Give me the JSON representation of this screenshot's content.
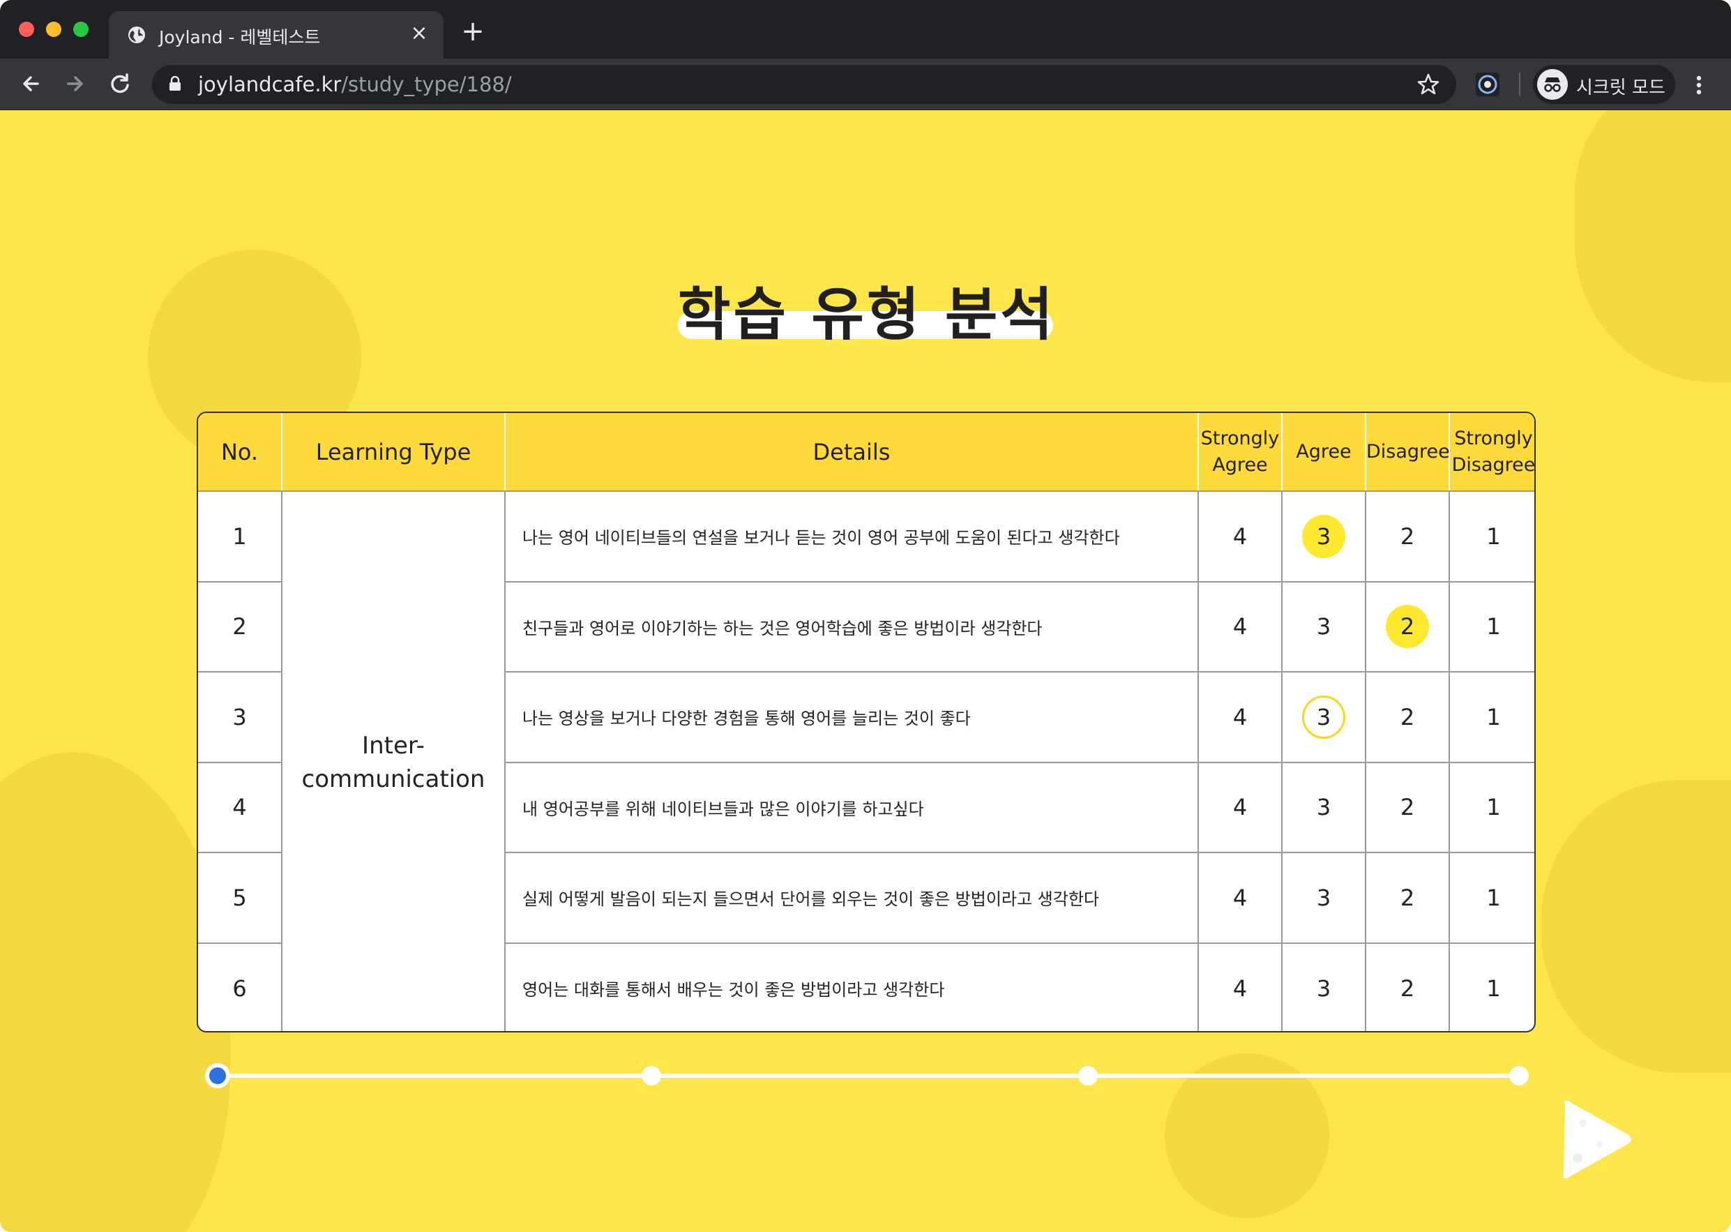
{
  "browser": {
    "tab_title": "Joyland - 레벨테스트",
    "url_host": "joylandcafe.kr",
    "url_path": "/study_type/188/",
    "incognito_label": "시크릿 모드"
  },
  "page": {
    "title": "학습 유형 분석",
    "headers": {
      "no": "No.",
      "learning_type": "Learning Type",
      "details": "Details",
      "strongly_agree_1": "Strongly",
      "strongly_agree_2": "Agree",
      "agree": "Agree",
      "disagree": "Disagree",
      "strongly_disagree_1": "Strongly",
      "strongly_disagree_2": "Disagree"
    },
    "learning_type_1": "Inter-",
    "learning_type_2": "communication",
    "rows": [
      {
        "no": "1",
        "detail": "나는 영어 네이티브들의 연설을 보거나 듣는 것이 영어 공부에 도움이 된다고 생각한다",
        "s4": "4",
        "s3": "3",
        "s2": "2",
        "s1": "1",
        "selected": "3"
      },
      {
        "no": "2",
        "detail": "친구들과 영어로 이야기하는 하는 것은 영어학습에 좋은 방법이라 생각한다",
        "s4": "4",
        "s3": "3",
        "s2": "2",
        "s1": "1",
        "selected": "2"
      },
      {
        "no": "3",
        "detail": "나는 영상을 보거나 다양한 경험을 통해 영어를 늘리는 것이 좋다",
        "s4": "4",
        "s3": "3",
        "s2": "2",
        "s1": "1",
        "hover": "3"
      },
      {
        "no": "4",
        "detail": "내 영어공부를 위해 네이티브들과 많은 이야기를 하고싶다",
        "s4": "4",
        "s3": "3",
        "s2": "2",
        "s1": "1"
      },
      {
        "no": "5",
        "detail": "실제 어떻게 발음이 되는지 들으면서 단어를 외우는 것이 좋은 방법이라고 생각한다",
        "s4": "4",
        "s3": "3",
        "s2": "2",
        "s1": "1"
      },
      {
        "no": "6",
        "detail": "영어는 대화를 통해서 배우는 것이 좋은 방법이라고 생각한다",
        "s4": "4",
        "s3": "3",
        "s2": "2",
        "s1": "1"
      }
    ],
    "progress": {
      "steps": 4,
      "current": 1
    },
    "colors": {
      "background": "#fde54b",
      "header": "#fdda3a",
      "selected": "#fde830",
      "progress_active": "#2f6fe4"
    }
  }
}
